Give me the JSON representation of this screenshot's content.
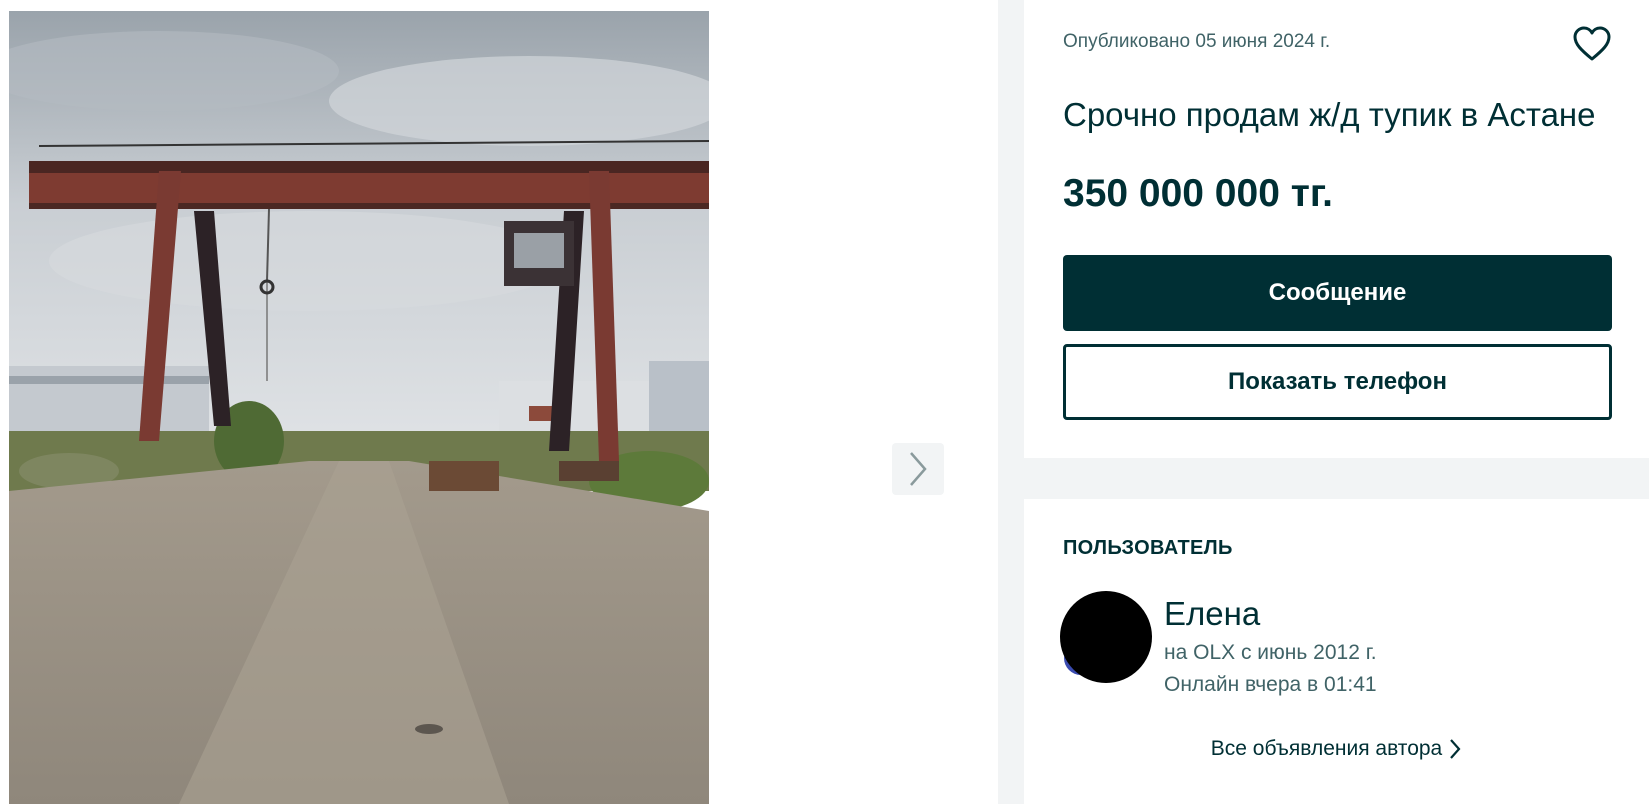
{
  "gallery": {
    "photo_alt": "",
    "next_icon": "chevron-right-icon"
  },
  "ad": {
    "published": "Опубликовано 05 июня 2024 г.",
    "favorite_icon": "heart-icon",
    "title": "Срочно продам ж/д тупик в Астане",
    "price": "350 000 000 тг.",
    "message_button": "Сообщение",
    "phone_button": "Показать телефон"
  },
  "user": {
    "heading": "ПОЛЬЗОВАТЕЛЬ",
    "name": "Елена",
    "since": "на OLX с июнь 2012 г.",
    "online": "Онлайн вчера в 01:41",
    "all_ads_link": "Все объявления автора",
    "all_ads_icon": "chevron-right-icon"
  },
  "colors": {
    "primary": "#002f34",
    "secondary_text": "#406367",
    "panel_bg": "#f2f4f5",
    "avatar_badge": "#3a4bb0"
  }
}
